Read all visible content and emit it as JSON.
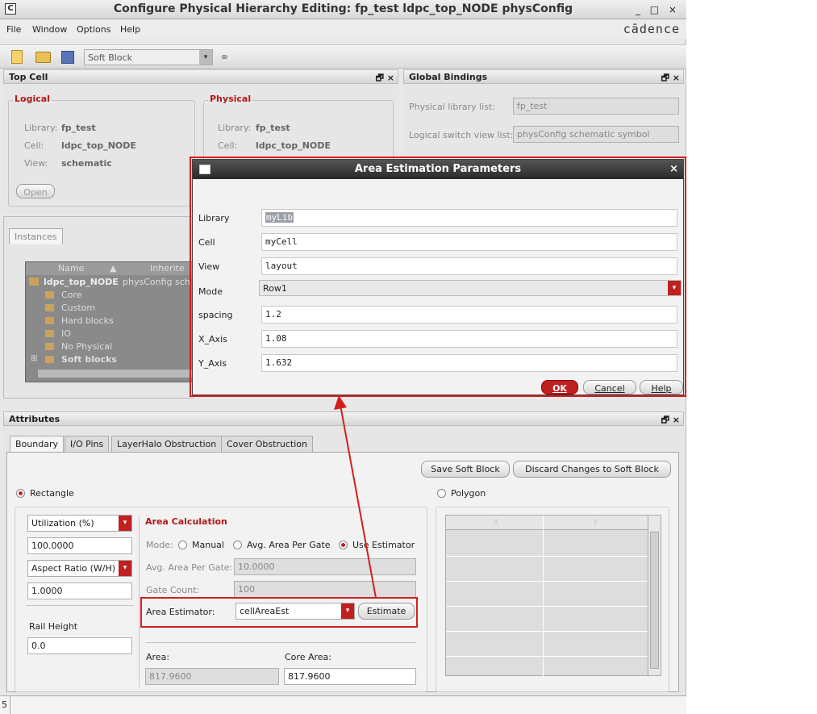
{
  "window": {
    "title": "Configure Physical Hierarchy Editing: fp_test ldpc_top_NODE physConfig",
    "controls": "_ □ ×",
    "brand": "cādence"
  },
  "menu": [
    "File",
    "Window",
    "Options",
    "Help"
  ],
  "toolbar": {
    "combo_value": "Soft Block"
  },
  "top_cell": {
    "title": "Top Cell",
    "ctrls": "🗗 ×",
    "logical": {
      "heading": "Logical",
      "library_label": "Library:",
      "library": "fp_test",
      "cell_label": "Cell:",
      "cell": "ldpc_top_NODE",
      "view_label": "View:",
      "view": "schematic",
      "open_label": "Open"
    },
    "physical": {
      "heading": "Physical",
      "library_label": "Library:",
      "library": "fp_test",
      "cell_label": "Cell:",
      "cell": "ldpc_top_NODE"
    }
  },
  "global_bindings": {
    "title": "Global Bindings",
    "ctrls": "🗗 ×",
    "phys_lib_label": "Physical library list:",
    "phys_lib": "fp_test",
    "switch_label": "Logical switch view list:",
    "switch": "physConfig schematic symbol"
  },
  "instances": {
    "tab": "Instances",
    "col_name": "Name",
    "col_inherited": "Inherite",
    "root": "ldpc_top_NODE",
    "root_inherited": "physConfig sch",
    "items": [
      "Core",
      "Custom",
      "Hard blocks",
      "IO",
      "No Physical",
      "Soft blocks"
    ]
  },
  "dialog": {
    "title": "Area Estimation Parameters",
    "close": "×",
    "fields": [
      {
        "label": "Library",
        "value": "myLib"
      },
      {
        "label": "Cell",
        "value": "myCell"
      },
      {
        "label": "View",
        "value": "layout"
      },
      {
        "label": "Mode",
        "value": "Row1"
      },
      {
        "label": "spacing",
        "value": "1.2"
      },
      {
        "label": "X_Axis",
        "value": "1.08"
      },
      {
        "label": "Y_Axis",
        "value": "1.632"
      }
    ],
    "ok": "OK",
    "cancel": "Cancel",
    "help": "Help"
  },
  "attributes": {
    "title": "Attributes",
    "ctrls": "🗗 ×",
    "tabs": [
      "Boundary",
      "I/O Pins",
      "LayerHalo Obstruction",
      "Cover Obstruction"
    ],
    "save_soft_block": "Save Soft Block",
    "discard": "Discard Changes to Soft Block",
    "rectangle": "Rectangle",
    "polygon": "Polygon",
    "utilization": "Utilization (%)",
    "utilization_value": "100.0000",
    "aspect": "Aspect Ratio (W/H)",
    "aspect_value": "1.0000",
    "rail_height_label": "Rail Height",
    "rail_height": "0.0",
    "area_calc": {
      "heading": "Area Calculation",
      "mode_label": "Mode:",
      "manual": "Manual",
      "avg_area": "Avg. Area Per Gate",
      "use_estimator": "Use Estimator",
      "avg_area_label": "Avg. Area Per Gate:",
      "avg_area_value": "10.0000",
      "gate_count_label": "Gate Count:",
      "gate_count": "100",
      "estimator_label": "Area Estimator:",
      "estimator": "cellAreaEst",
      "estimate_btn": "Estimate",
      "area_label": "Area:",
      "area": "817.9600",
      "core_area_label": "Core Area:",
      "core_area": "817.9600"
    },
    "grid_cols": [
      "X",
      "Y"
    ]
  },
  "status": "5",
  "colors": {
    "accent": "#c02020",
    "highlight": "#d41e1e"
  }
}
